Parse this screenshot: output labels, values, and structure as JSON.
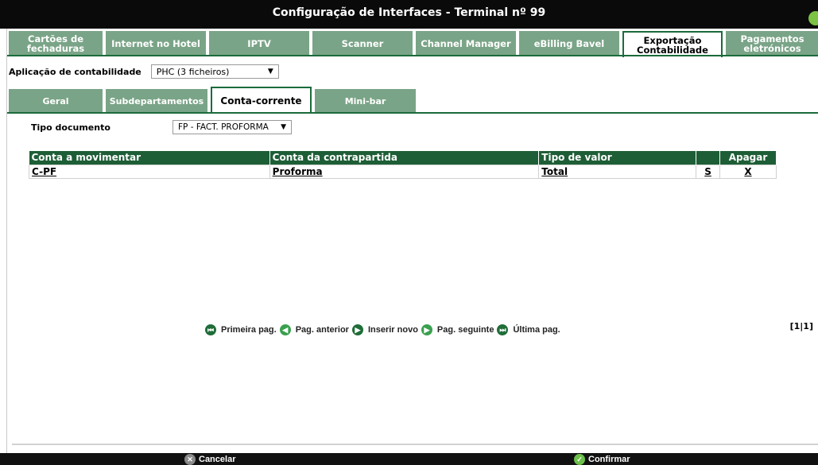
{
  "window": {
    "title": "Configuração de Interfaces - Terminal nº 99"
  },
  "tabs_top": [
    {
      "label_1": "Cartões de",
      "label_2": "fechaduras"
    },
    {
      "label_1": "Internet no Hotel",
      "label_2": ""
    },
    {
      "label_1": "IPTV",
      "label_2": ""
    },
    {
      "label_1": "Scanner",
      "label_2": ""
    },
    {
      "label_1": "Channel Manager",
      "label_2": ""
    },
    {
      "label_1": "eBilling Bavel",
      "label_2": ""
    },
    {
      "label_1": "Exportação",
      "label_2": "Contabilidade"
    },
    {
      "label_1": "Pagamentos",
      "label_2": "eletrónicos"
    }
  ],
  "app": {
    "label": "Aplicação de contabilidade",
    "selected": "PHC (3 ficheiros)"
  },
  "tabs_sub": [
    {
      "label": "Geral"
    },
    {
      "label": "Subdepartamentos"
    },
    {
      "label": "Conta-corrente"
    },
    {
      "label": "Mini-bar"
    }
  ],
  "doc": {
    "label": "Tipo documento",
    "selected": "FP - FACT. PROFORMA"
  },
  "table": {
    "headers": [
      "Conta a movimentar",
      "Conta da contrapartida",
      "Tipo de valor",
      "",
      "Apagar"
    ],
    "rows": [
      {
        "conta": "C-PF",
        "contrapartida": "Proforma",
        "tipo": "Total",
        "s": "S",
        "apagar": "X"
      }
    ]
  },
  "pager": {
    "first": "Primeira pag.",
    "prev": "Pag. anterior",
    "insert": "Inserir novo",
    "next": "Pag. seguinte",
    "last": "Última pag.",
    "count": "[1|1]"
  },
  "footer": {
    "cancel": "Cancelar",
    "confirm": "Confirmar"
  },
  "colors": {
    "tab_inactive": "#7aa487",
    "tab_border": "#1b6b3c",
    "header_bg": "#1e5e36",
    "accent_green": "#3aa04f"
  }
}
